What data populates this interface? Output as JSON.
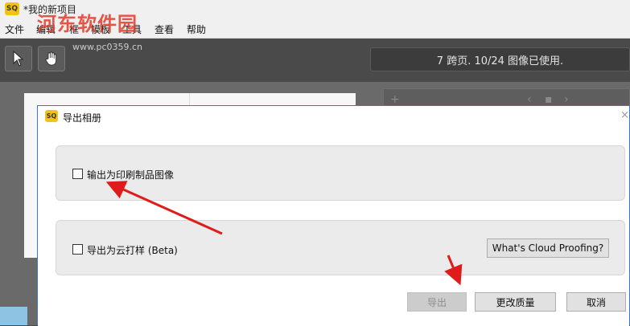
{
  "window": {
    "title": "*我的新项目",
    "app_icon_text": "SQ"
  },
  "watermark": {
    "text": "河东软件园",
    "url": "www.pc0359.cn"
  },
  "menu": [
    "文件",
    "编辑",
    "框",
    "模板",
    "工具",
    "查看",
    "帮助"
  ],
  "toolbar": {
    "select_tool_icon": "cursor-arrow-icon",
    "hand_tool_icon": "hand-pan-icon",
    "status_text": "7 跨页. 10/24 图像已使用."
  },
  "dialog": {
    "title": "导出相册",
    "icon_text": "SQ",
    "close_glyph": "×",
    "options": {
      "print": {
        "label": "输出为印刷制品图像",
        "checked": false
      },
      "cloud": {
        "label": "导出为云打样 (Beta)",
        "checked": false,
        "info_button": "What's Cloud Proofing?"
      }
    },
    "buttons": {
      "export": {
        "label": "导出",
        "enabled": false
      },
      "quality": {
        "label": "更改质量"
      },
      "cancel": {
        "label": "取消"
      }
    }
  },
  "colors": {
    "annotation_arrow": "#e01b1b",
    "dialog_border": "#3a77c4",
    "app_icon": "#f3c313"
  }
}
